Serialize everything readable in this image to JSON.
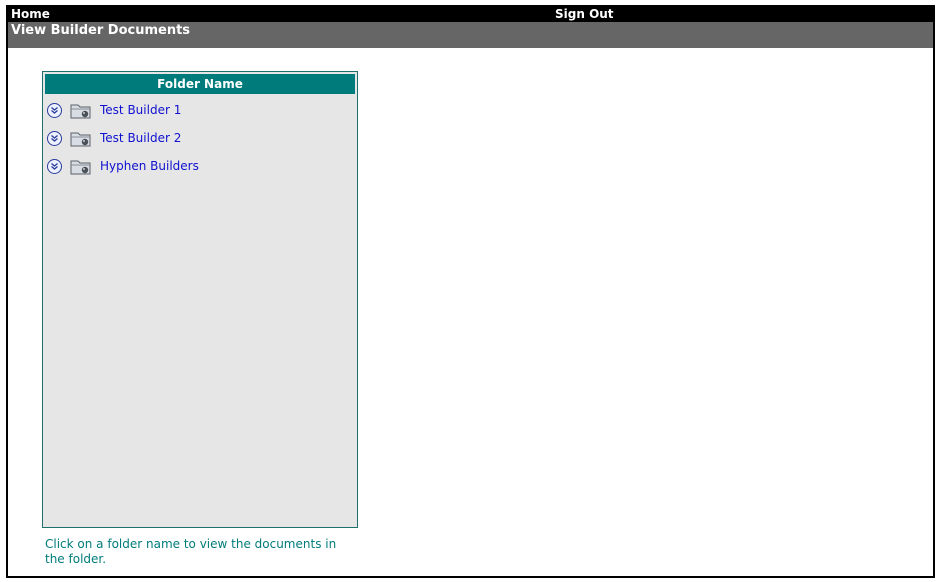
{
  "nav": {
    "home_label": "Home",
    "sign_out_label": "Sign Out"
  },
  "page": {
    "title": "View Builder Documents"
  },
  "folder_panel": {
    "header": "Folder Name",
    "folders": [
      {
        "label": "Test Builder 1",
        "icon": "folder-icon",
        "expand_icon": "chevron-down-circle-icon"
      },
      {
        "label": "Test Builder 2",
        "icon": "folder-icon",
        "expand_icon": "chevron-down-circle-icon"
      },
      {
        "label": "Hyphen Builders",
        "icon": "folder-icon",
        "expand_icon": "chevron-down-circle-icon"
      }
    ]
  },
  "hint": "Click on a folder name to view the documents in the folder.",
  "colors": {
    "header_bg": "#007b7b",
    "topbar_bg": "#000000",
    "titlebar_bg": "#666666",
    "panel_bg": "#e6e6e6",
    "link": "#1010d0",
    "hint_text": "#007b7b"
  }
}
